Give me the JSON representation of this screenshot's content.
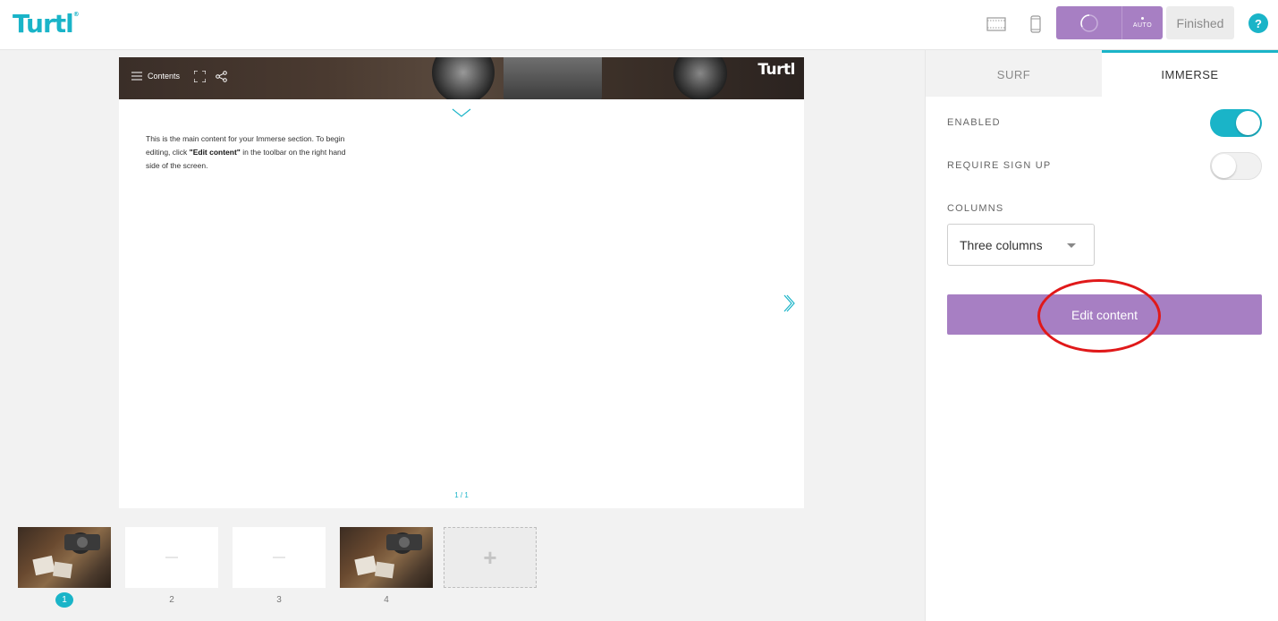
{
  "app": {
    "logo": "Turtl",
    "logo_mark": "®"
  },
  "toolbar": {
    "desktop_icon": "desktop-view-icon",
    "mobile_icon": "mobile-view-icon",
    "preview_icon": "loading-circle-icon",
    "auto_label": "AUTO",
    "finished_label": "Finished",
    "help_label": "?"
  },
  "canvas": {
    "contents_label": "Contents",
    "hero_logo": "Turtl",
    "body_prefix": "This is the main content for your Immerse section. To begin editing, click ",
    "body_bold": "\"Edit content\"",
    "body_suffix": " in the toolbar on the right hand side of the screen.",
    "pager": "1 / 1"
  },
  "thumbnails": [
    {
      "number": "1",
      "kind": "photo",
      "active": true
    },
    {
      "number": "2",
      "kind": "blank",
      "active": false
    },
    {
      "number": "3",
      "kind": "blank",
      "active": false
    },
    {
      "number": "4",
      "kind": "photo",
      "active": false
    }
  ],
  "add_page_label": "+",
  "panel": {
    "tabs": [
      {
        "label": "SURF",
        "active": false
      },
      {
        "label": "IMMERSE",
        "active": true
      }
    ],
    "enabled_label": "ENABLED",
    "enabled_value": true,
    "require_signup_label": "REQUIRE SIGN UP",
    "require_signup_value": false,
    "columns_label": "COLUMNS",
    "columns_value": "Three columns",
    "edit_button": "Edit content"
  },
  "colors": {
    "accent": "#1ab4c8",
    "purple": "#a77fc3",
    "annotation": "#e0191a"
  }
}
